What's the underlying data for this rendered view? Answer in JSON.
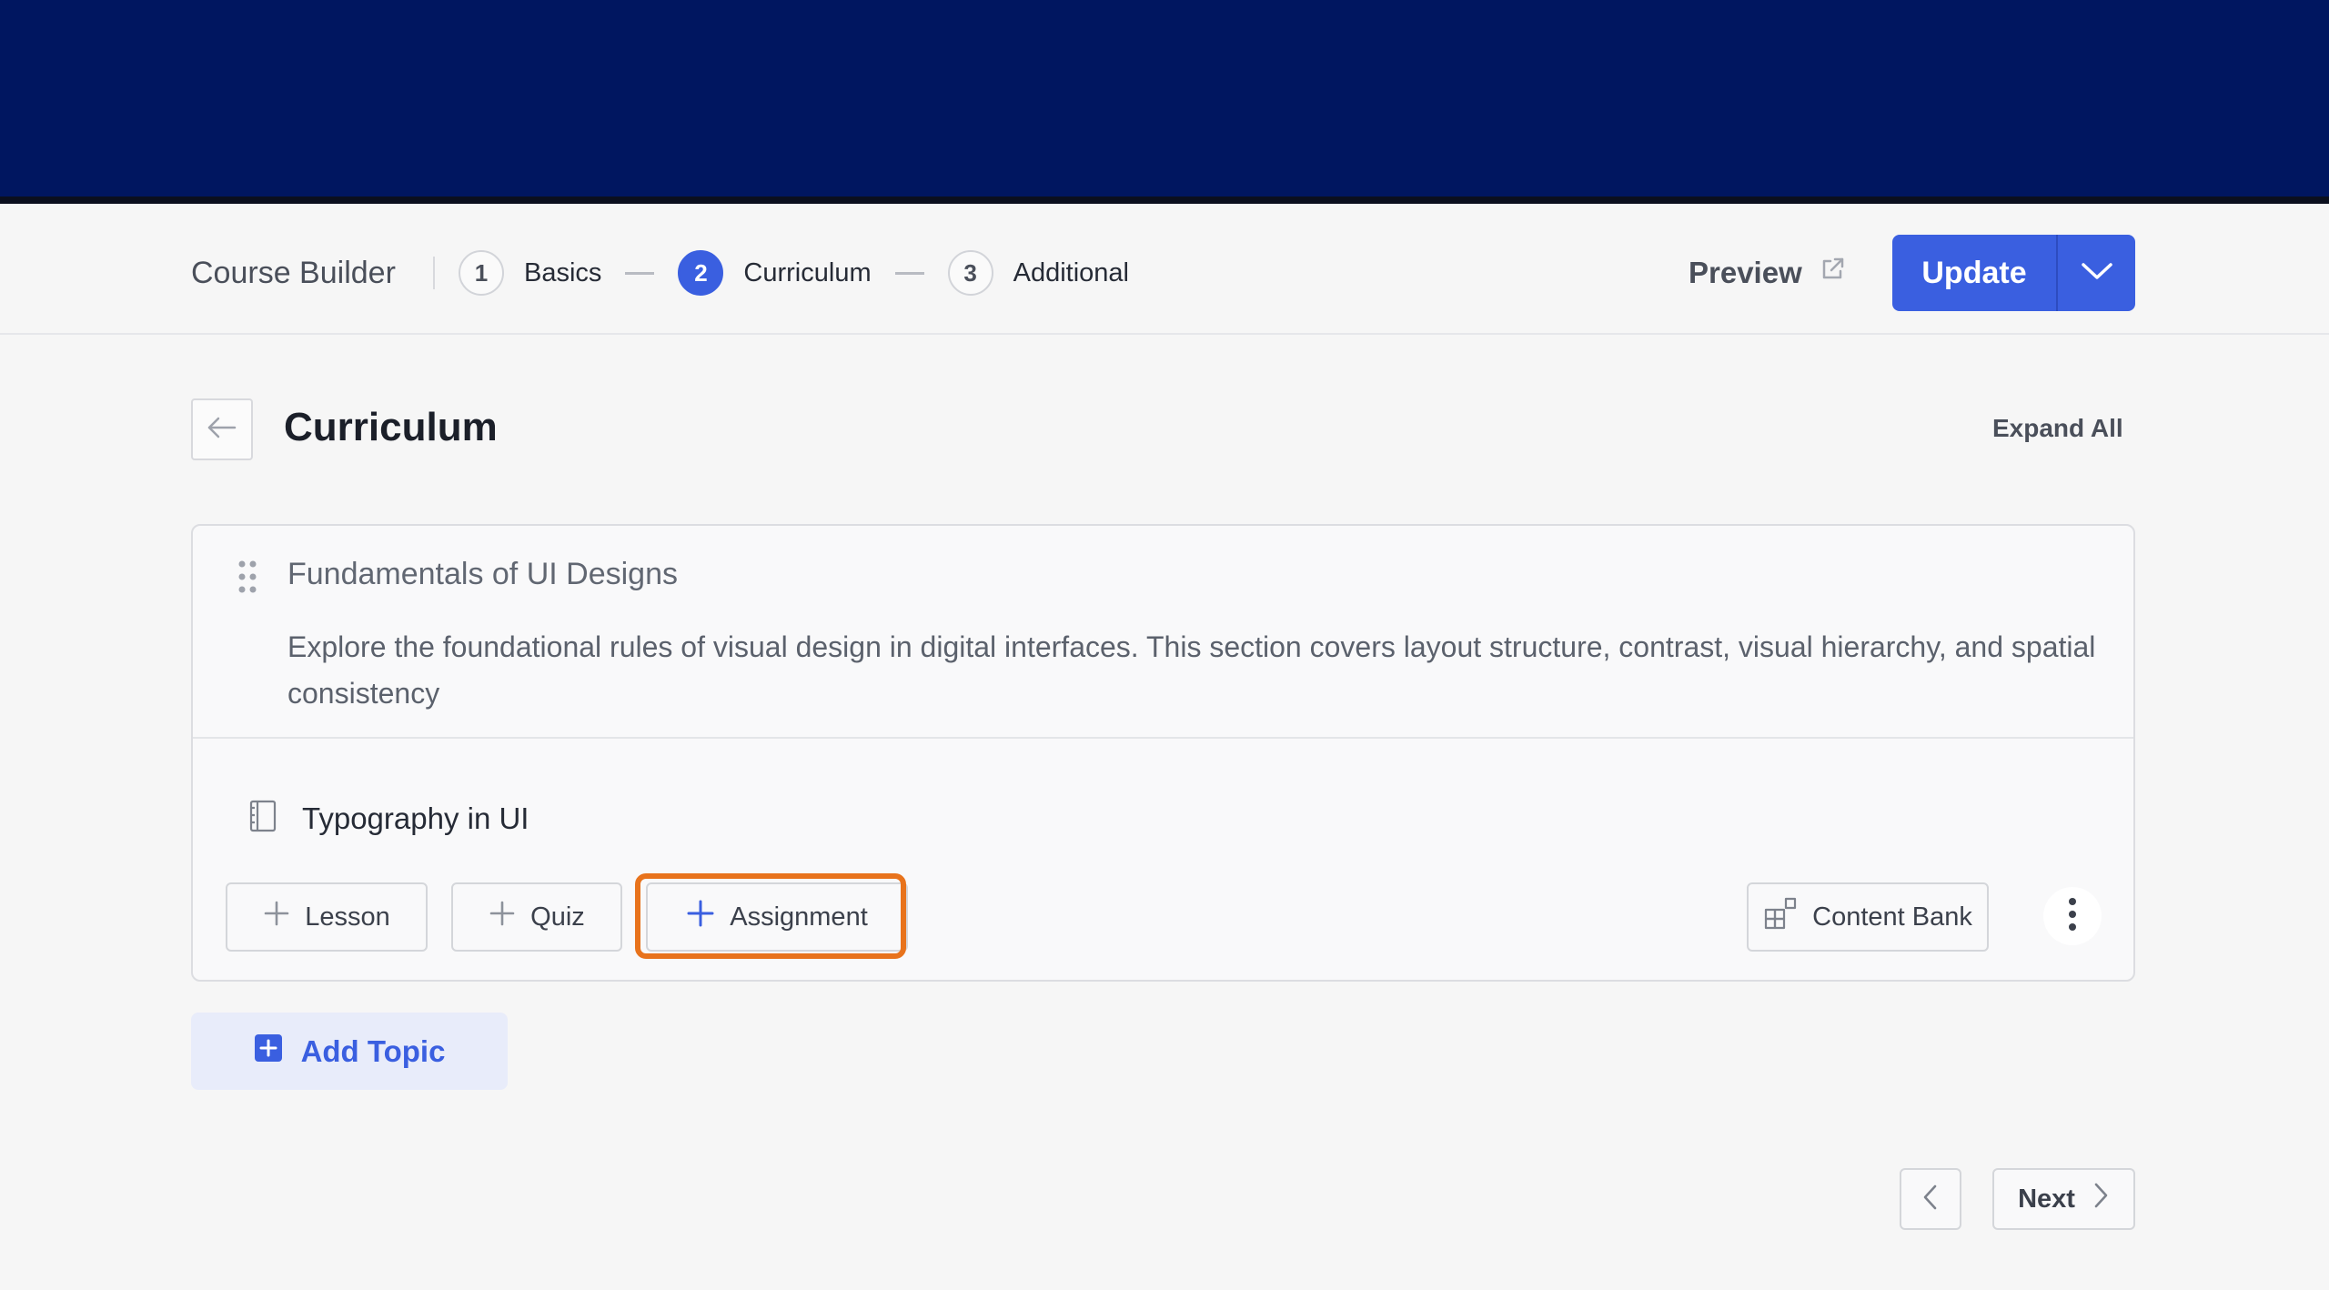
{
  "header": {
    "brand": "Course Builder",
    "steps": [
      {
        "num": "1",
        "label": "Basics"
      },
      {
        "num": "2",
        "label": "Curriculum"
      },
      {
        "num": "3",
        "label": "Additional"
      }
    ],
    "active_step": 2,
    "preview_label": "Preview",
    "update_label": "Update"
  },
  "page": {
    "title": "Curriculum",
    "expand_all_label": "Expand All"
  },
  "topic": {
    "title": "Fundamentals of UI Designs",
    "description": "Explore the foundational rules of visual design in digital interfaces. This section covers layout structure, contrast, visual hierarchy, and spatial consistency",
    "lesson_title": "Typography in UI",
    "actions": {
      "lesson": "Lesson",
      "quiz": "Quiz",
      "assignment": "Assignment",
      "content_bank": "Content Bank"
    }
  },
  "add_topic_label": "Add Topic",
  "pagination": {
    "next_label": "Next"
  },
  "colors": {
    "top_band": "#001660",
    "primary": "#3a5fe0",
    "highlight": "#e8731c"
  }
}
